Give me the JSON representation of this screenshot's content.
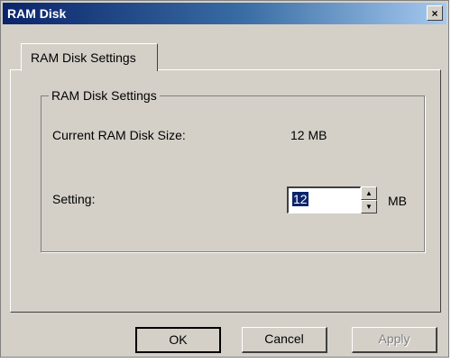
{
  "window": {
    "title": "RAM Disk",
    "close_label": "×"
  },
  "tabs": [
    {
      "label": "RAM Disk Settings"
    }
  ],
  "group": {
    "title": "RAM Disk Settings",
    "current_size_label": "Current RAM Disk Size:",
    "current_size_value": "12 MB",
    "setting_label": "Setting:",
    "setting_value": "12",
    "setting_unit": "MB",
    "spin_up": "▲",
    "spin_down": "▼"
  },
  "buttons": {
    "ok": "OK",
    "cancel": "Cancel",
    "apply": "Apply"
  }
}
